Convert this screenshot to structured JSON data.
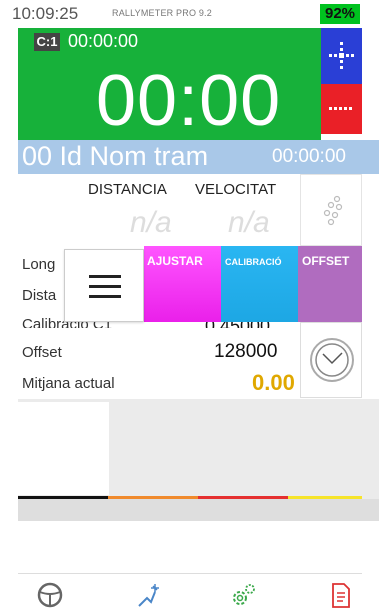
{
  "status": {
    "time": "10:09:25",
    "app_name": "RALLYMETER PRO 9.2",
    "battery": "92%"
  },
  "timer": {
    "badge": "C:1",
    "sub_time": "00:00:00",
    "main_time": "00:00"
  },
  "tram": {
    "name": "00 Id Nom tram",
    "time": "00:00:00"
  },
  "metrics": {
    "distance_label": "DISTANCIA",
    "velocity_label": "VELOCITAT",
    "distance_value": "n/a",
    "velocity_value": "n/a"
  },
  "tabs": {
    "ajustar": "AJUSTAR",
    "calibracio": "CALIBRACIÓ",
    "offset": "OFFSET"
  },
  "rows": {
    "row1_label": "Long",
    "row2_label": "Dista",
    "row3_label": "Calibració C1",
    "row3_value": "0.45000",
    "row4_label": "Offset",
    "row4_value": "128000",
    "row5_label": "Mitjana actual",
    "row5_value": "0.00"
  },
  "icons": {
    "move": "move-arrows-icon",
    "menu_dots": "more-dots-icon",
    "dots_pattern": "dots-pattern-icon",
    "hamburger": "hamburger-menu-icon",
    "clock": "clock-icon",
    "wheel": "steering-wheel-icon",
    "gear_hand": "gear-hand-icon",
    "settings": "settings-gears-icon",
    "document": "document-icon"
  },
  "colors": {
    "green": "#17b13a",
    "blue": "#2a3fd6",
    "red": "#ea2027",
    "tram_bar": "#a9c8e8",
    "magenta": "#ea20ea",
    "cyan": "#1da7e4",
    "purple": "#b06cbf",
    "accent_yellow": "#e0a800"
  }
}
